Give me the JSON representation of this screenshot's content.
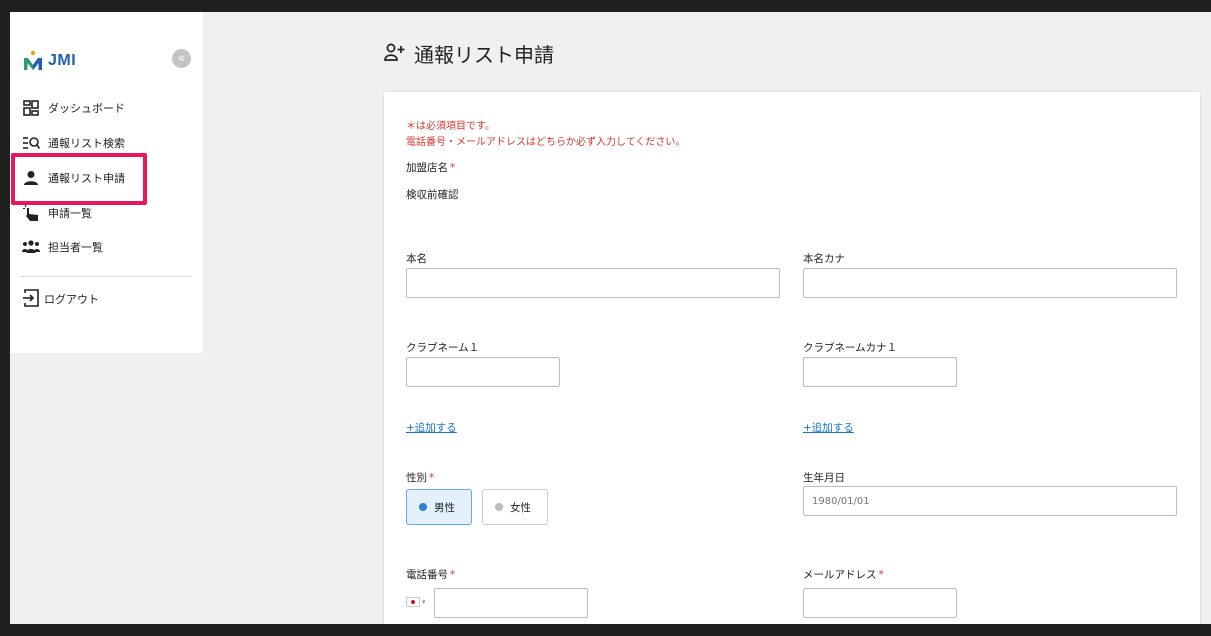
{
  "brand": {
    "name": "JMI",
    "collapse_glyph": "«"
  },
  "sidebar": {
    "items": [
      {
        "label": "ダッシュボード",
        "icon": "dashboard-grid-icon"
      },
      {
        "label": "通報リスト検索",
        "icon": "list-search-icon"
      },
      {
        "label": "通報リスト申請",
        "icon": "person-icon",
        "active": true
      },
      {
        "label": "申請一覧",
        "icon": "hand-tap-icon"
      },
      {
        "label": "担当者一覧",
        "icon": "people-group-icon"
      }
    ],
    "logout": {
      "label": "ログアウト",
      "icon": "logout-icon"
    }
  },
  "page": {
    "title": "通報リスト申請",
    "title_icon": "add-person-icon"
  },
  "form": {
    "notes": [
      "＊は必須項目です。",
      "電話番号・メールアドレスはどちらか必ず入力してください。"
    ],
    "store": {
      "label": "加盟店名",
      "value": "検収前確認"
    },
    "real_name": {
      "label": "本名",
      "value": ""
    },
    "real_name_kana": {
      "label": "本名カナ",
      "value": ""
    },
    "club_name": {
      "label": "クラブネーム１",
      "value": ""
    },
    "club_name_kana": {
      "label": "クラブネームカナ１",
      "value": ""
    },
    "add_label": "+追加する",
    "gender": {
      "label": "性別",
      "options": [
        "男性",
        "女性"
      ],
      "selected": "男性"
    },
    "birthdate": {
      "label": "生年月日",
      "placeholder": "1980/01/01",
      "value": ""
    },
    "phone": {
      "label": "電話番号",
      "value": ""
    },
    "email": {
      "label": "メールアドレス",
      "value": ""
    },
    "required_mark": "*"
  },
  "colors": {
    "accent": "#1f5fb0",
    "required": "#d9342b",
    "highlight": "#e8195a",
    "selected_bg": "#e3f0fd"
  }
}
